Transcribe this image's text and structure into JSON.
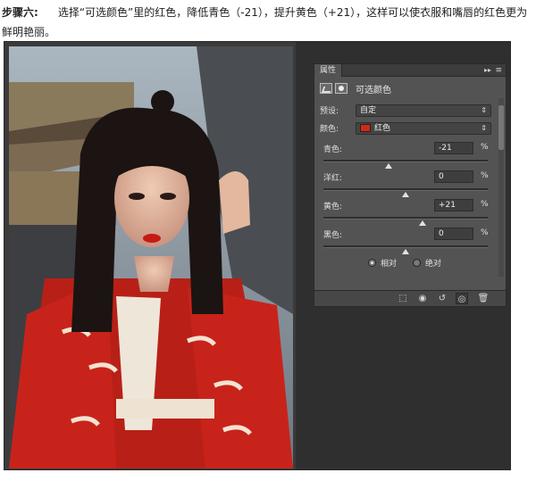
{
  "intro": {
    "step_label": "步骤六:",
    "text": "选择“可选颜色”里的红色，降低青色（-21），提升黄色（+21），这样可以使衣服和嘴唇的红色更为鲜明艳丽。"
  },
  "panel": {
    "tab_label": "属性",
    "arrows": "▸▸",
    "menu_glyph": "≡",
    "title": "可选颜色",
    "preset": {
      "label": "预设:",
      "value": "自定"
    },
    "colors": {
      "label": "颜色:",
      "value": "红色",
      "swatch": "#d12a12"
    },
    "sliders": [
      {
        "label": "青色:",
        "value": "-21",
        "unit": "%",
        "level": -21
      },
      {
        "label": "洋红:",
        "value": "0",
        "unit": "%",
        "level": 0
      },
      {
        "label": "黄色:",
        "value": "+21",
        "unit": "%",
        "level": 21
      },
      {
        "label": "黑色:",
        "value": "0",
        "unit": "%",
        "level": 0
      }
    ],
    "mode": {
      "relative": "相对",
      "absolute": "绝对",
      "selected": "relative"
    }
  },
  "colors": {
    "panel_bg": "#535353",
    "workspace": "#3b3b3b",
    "dress_red": "#c8231a"
  },
  "icons": [
    "clip-to-layer-icon",
    "view-previous-icon",
    "reset-icon",
    "visibility-eye-icon",
    "trash-icon",
    "mask-icon",
    "adjustment-icon"
  ]
}
